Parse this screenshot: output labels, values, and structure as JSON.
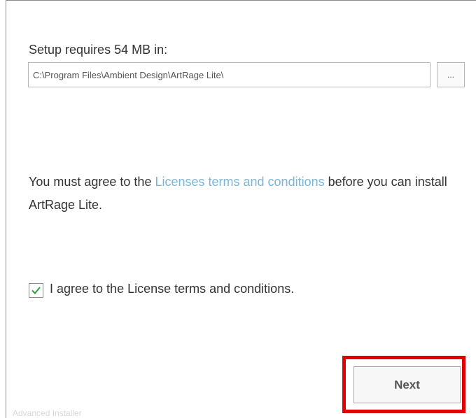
{
  "setup": {
    "space_label": "Setup requires 54 MB in:",
    "install_path": "C:\\Program Files\\Ambient Design\\ArtRage Lite\\",
    "browse_label": "..."
  },
  "license": {
    "prefix": "You must agree to the ",
    "link_text": "Licenses terms and conditions",
    "suffix": " before you can install ArtRage Lite.",
    "link_color": "#7bb5d8"
  },
  "agreement": {
    "checked": true,
    "label": "I agree to the License terms and conditions."
  },
  "actions": {
    "next_label": "Next",
    "highlight_color": "#e10000"
  },
  "footer": {
    "brand": "Advanced Installer"
  }
}
